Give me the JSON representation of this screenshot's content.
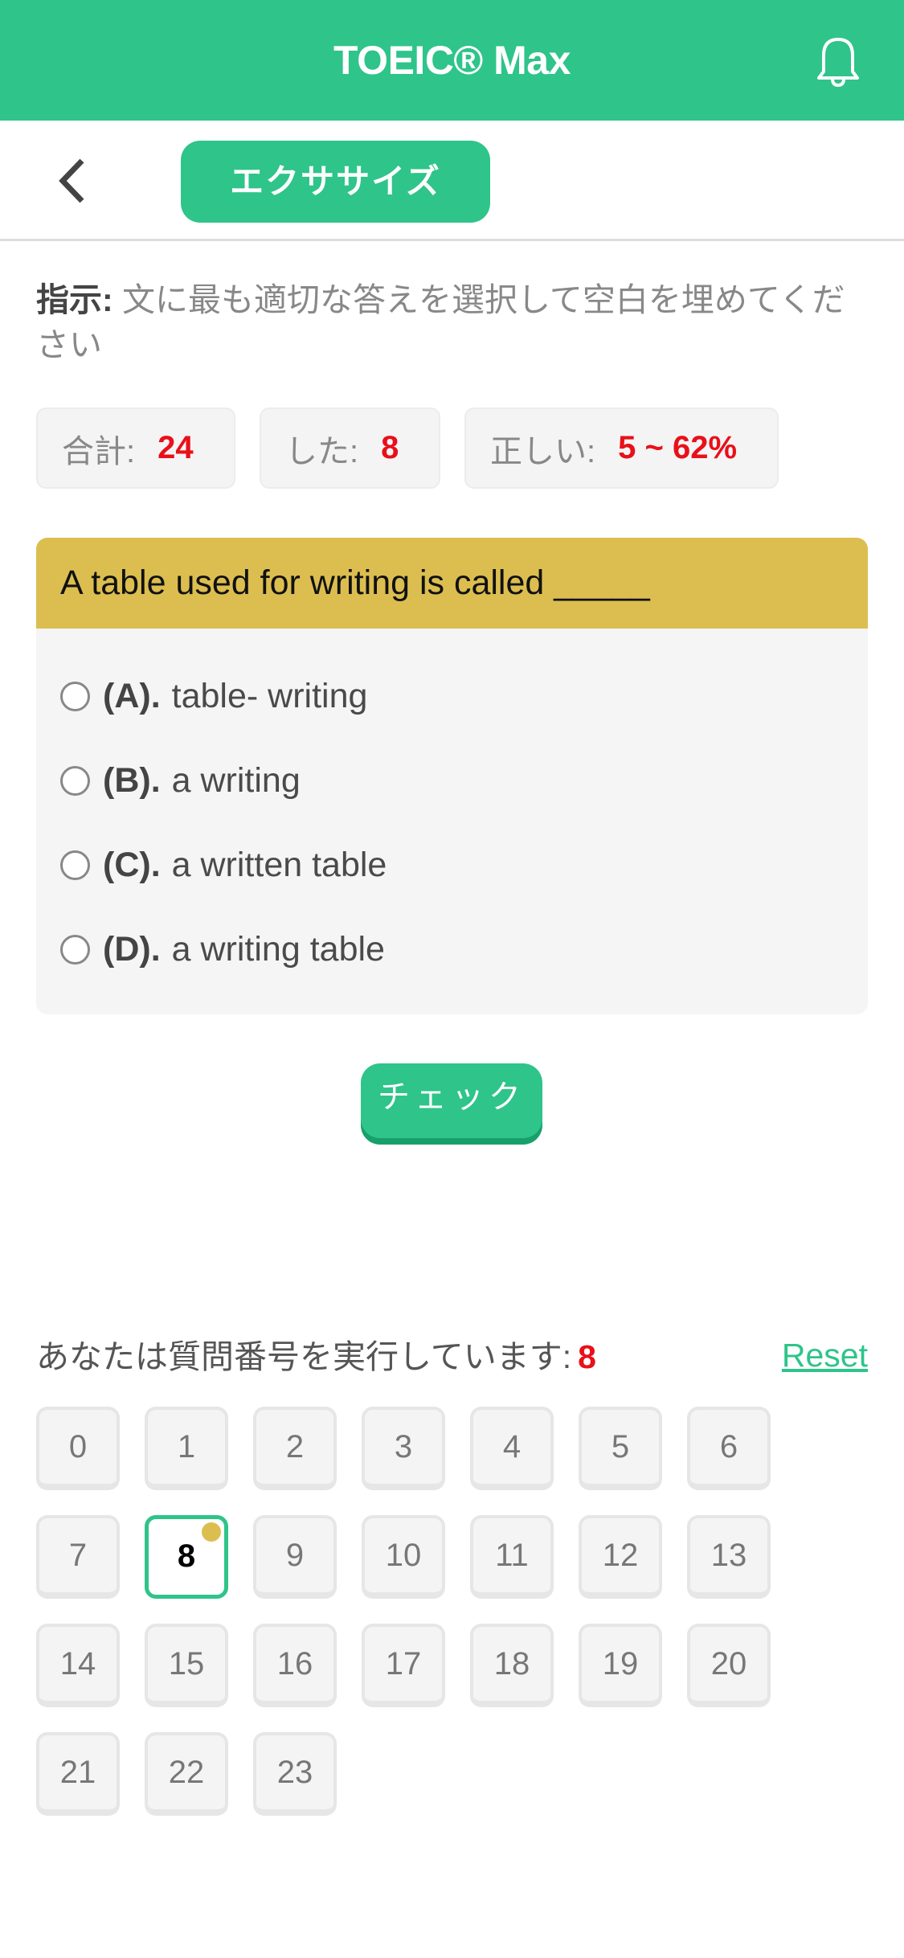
{
  "header": {
    "title": "TOEIC® Max",
    "bell_icon": "bell-icon"
  },
  "subbar": {
    "back_icon": "chevron-left-icon",
    "tab_label": "エクササイズ"
  },
  "instruction": {
    "label": "指示:",
    "text": " 文に最も適切な答えを選択して空白を埋めてください"
  },
  "stats": [
    {
      "label": "合計:",
      "value": "24"
    },
    {
      "label": "した:",
      "value": "8"
    },
    {
      "label": "正しい:",
      "value": "5 ~ 62%"
    }
  ],
  "question": {
    "text": "A table used for writing is called _____",
    "options": [
      {
        "letter": "(A).",
        "text": "table- writing"
      },
      {
        "letter": "(B).",
        "text": "a writing"
      },
      {
        "letter": "(C).",
        "text": "a written table"
      },
      {
        "letter": "(D).",
        "text": "a writing table"
      }
    ]
  },
  "check_button": "チェック",
  "progress": {
    "label": "あなたは質問番号を実行しています:",
    "current": "8",
    "reset": "Reset"
  },
  "questions_grid": {
    "items": [
      "0",
      "1",
      "2",
      "3",
      "4",
      "5",
      "6",
      "7",
      "8",
      "9",
      "10",
      "11",
      "12",
      "13",
      "14",
      "15",
      "16",
      "17",
      "18",
      "19",
      "20",
      "21",
      "22",
      "23"
    ],
    "current_index": 8,
    "columns": 7,
    "colors": {
      "accent": "#2ec48a",
      "marker": "#dcbe50"
    }
  },
  "colors": {
    "brand": "#2ec48a",
    "question_header": "#dcbe50",
    "value_red": "#e8101a"
  }
}
